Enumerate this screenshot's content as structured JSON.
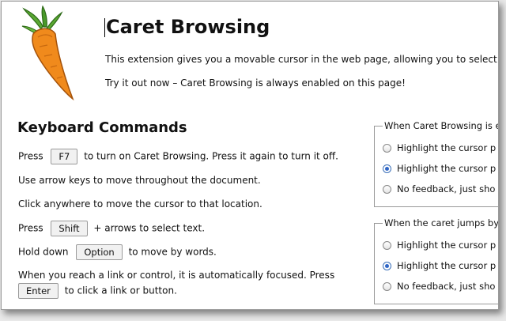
{
  "header": {
    "title": "Caret Browsing",
    "intro": "This extension gives you a movable cursor in the web page, allowing you to select text",
    "try_it": "Try it out now – Caret Browsing is always enabled on this page!"
  },
  "keyboard": {
    "heading": "Keyboard Commands",
    "f7": {
      "pre": "Press",
      "key": "F7",
      "post": "to turn on Caret Browsing. Press it again to turn it off."
    },
    "arrows": "Use arrow keys to move throughout the document.",
    "click": "Click anywhere to move the cursor to that location.",
    "shift": {
      "pre": "Press",
      "key": "Shift",
      "post": "+ arrows to select text."
    },
    "option": {
      "pre": "Hold down",
      "key": "Option",
      "post": "to move by words."
    },
    "enter": {
      "line1": "When you reach a link or control, it is automatically focused. Press",
      "key": "Enter",
      "post": "to click a link or button."
    }
  },
  "settings": {
    "group1": {
      "legend": "When Caret Browsing is e",
      "options": [
        "Highlight the cursor p",
        "Highlight the cursor p",
        "No feedback, just sho"
      ],
      "selected_index": 1
    },
    "group2": {
      "legend": "When the caret jumps by",
      "options": [
        "Highlight the cursor p",
        "Highlight the cursor p",
        "No feedback, just sho"
      ],
      "selected_index": 1
    }
  },
  "colors": {
    "accent_radio": "#2f66c6",
    "carrot_orange": "#f08a1c",
    "leaf_green": "#4a9a2a"
  }
}
